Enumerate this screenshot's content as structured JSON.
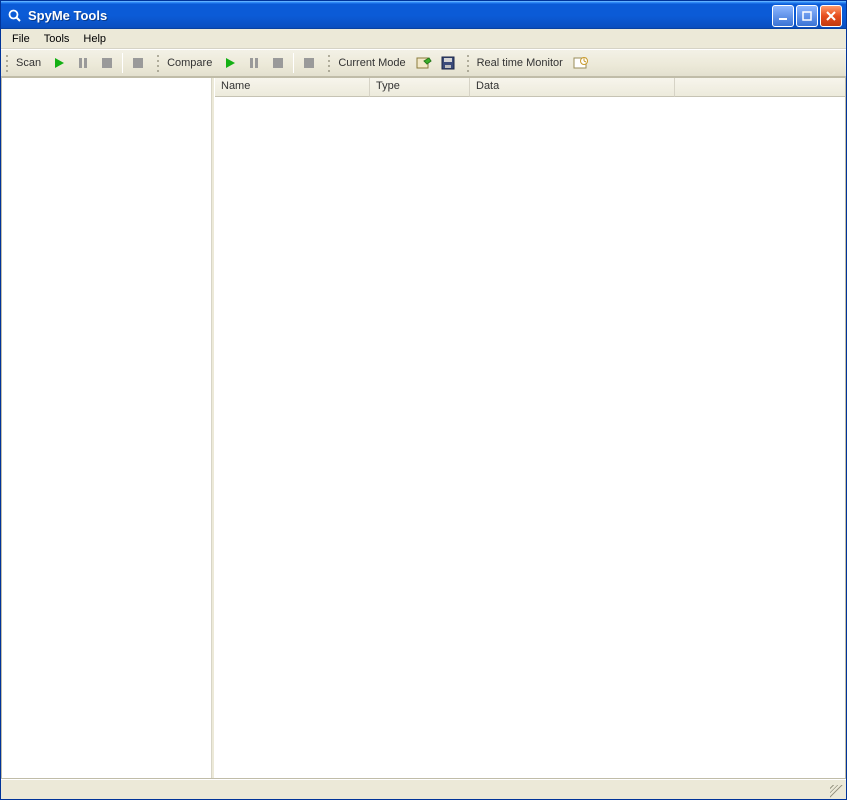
{
  "window": {
    "title": "SpyMe Tools"
  },
  "menu": {
    "file": "File",
    "tools": "Tools",
    "help": "Help"
  },
  "toolbar": {
    "scan_label": "Scan",
    "compare_label": "Compare",
    "current_mode_label": "Current Mode",
    "realtime_label": "Real time Monitor"
  },
  "columns": {
    "name": "Name",
    "type": "Type",
    "data": "Data"
  },
  "icons": {
    "app": "magnifier-icon",
    "play": "play-icon",
    "pause": "pause-icon",
    "stop": "stop-icon",
    "stop2": "stop-icon",
    "mode1": "registry-mode-icon",
    "mode2": "disk-mode-icon",
    "monitor": "monitor-icon"
  }
}
